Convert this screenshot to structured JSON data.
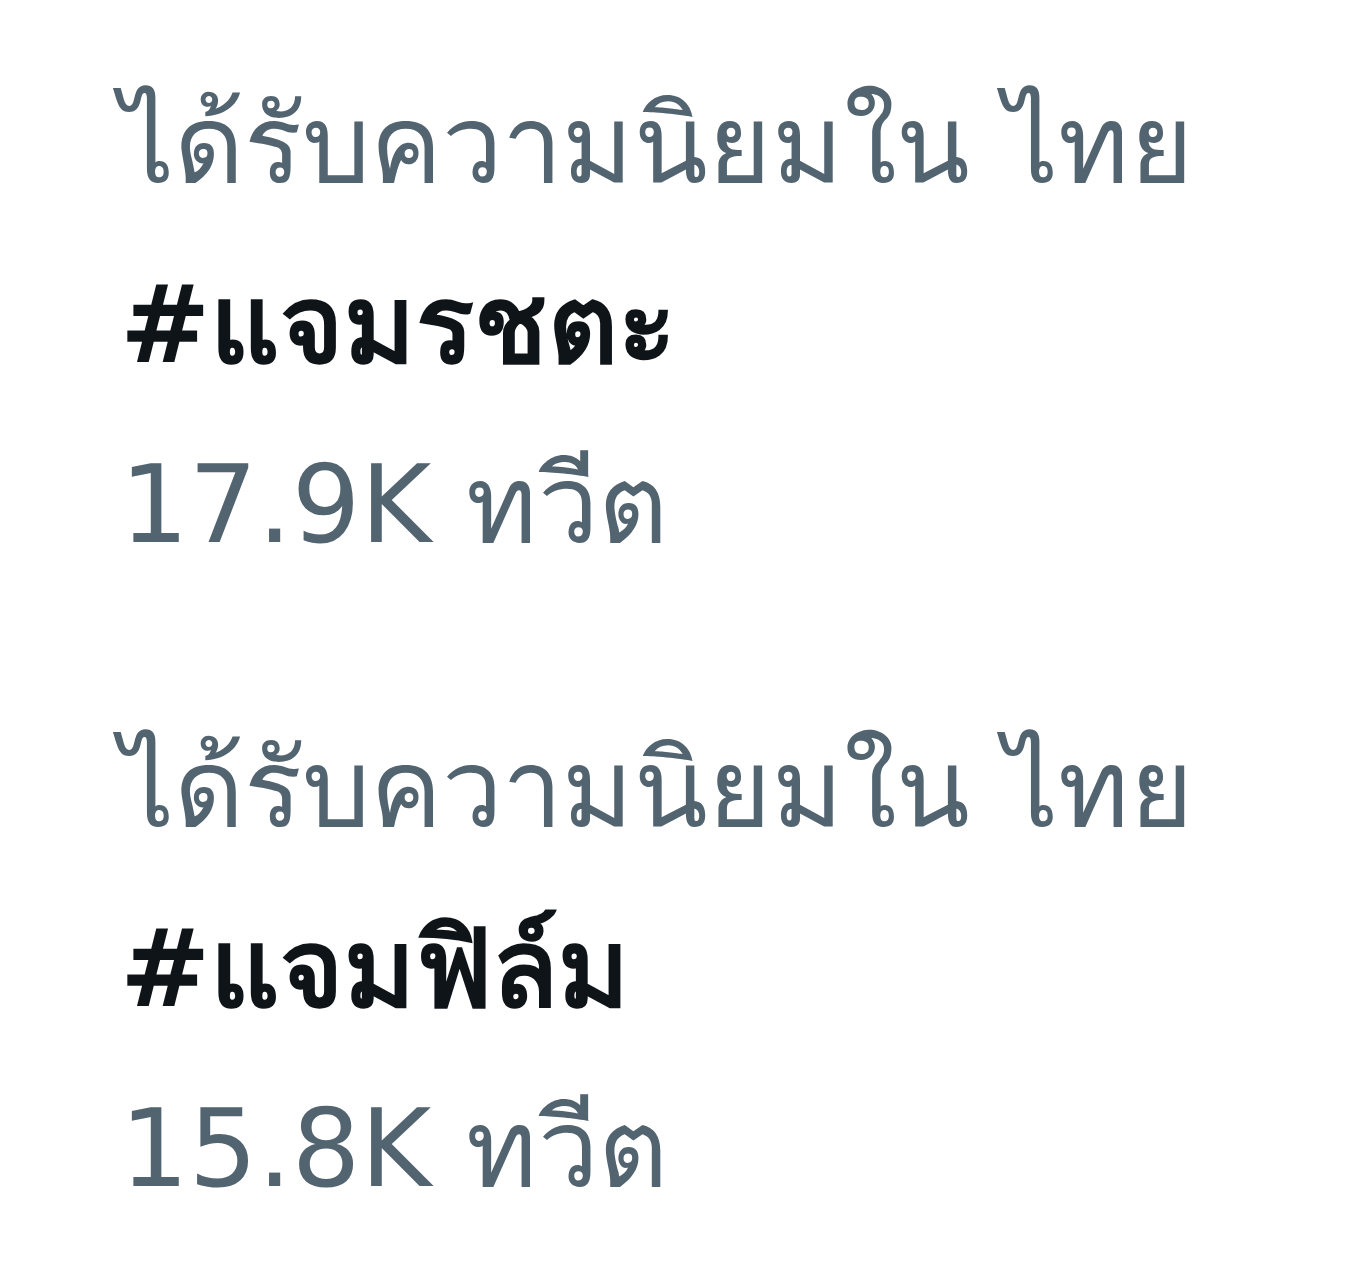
{
  "trends": [
    {
      "context": "ได้รับความนิยมใน ไทย",
      "hashtag": "#แจมรชตะ",
      "count": "17.9K ทวีต"
    },
    {
      "context": "ได้รับความนิยมใน ไทย",
      "hashtag": "#แจมฟิล์ม",
      "count": "15.8K ทวีต"
    }
  ]
}
